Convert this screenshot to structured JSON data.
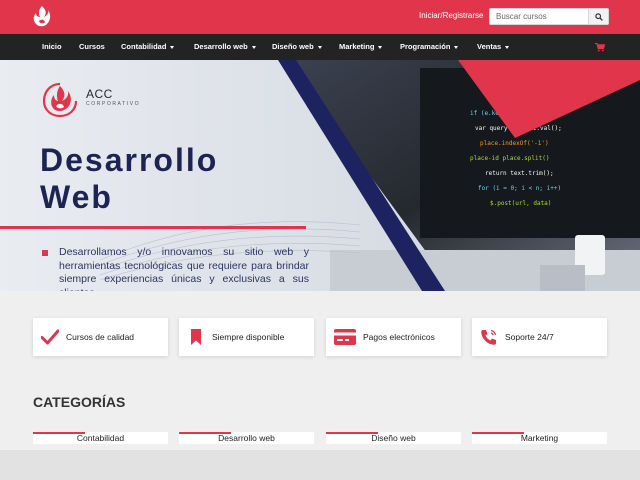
{
  "header": {
    "login_label": "Iniciar/Registrarse",
    "search_placeholder": "Buscar cursos",
    "brand_color": "#e0354a"
  },
  "nav": {
    "items": [
      {
        "label": "Inicio",
        "dropdown": false
      },
      {
        "label": "Cursos",
        "dropdown": false
      },
      {
        "label": "Contabilidad",
        "dropdown": true
      },
      {
        "label": "Desarrollo web",
        "dropdown": true
      },
      {
        "label": "Diseño web",
        "dropdown": true
      },
      {
        "label": "Marketing",
        "dropdown": true
      },
      {
        "label": "Programación",
        "dropdown": true
      },
      {
        "label": "Ventas",
        "dropdown": true
      }
    ],
    "cart_icon": "cart-icon"
  },
  "hero": {
    "brand_name": "ACC",
    "brand_sub": "CORPORATIVO",
    "title_line1": "Desarrollo",
    "title_line2": "Web",
    "description": "Desarrollamos y/o innovamos su sitio web y herramientas tecnológicas que requiere para brindar siempre experiencias únicas y exclusivas a sus clientes."
  },
  "features": [
    {
      "label": "Cursos de calidad",
      "icon": "check-icon"
    },
    {
      "label": "Siempre disponible",
      "icon": "bookmark-icon"
    },
    {
      "label": "Pagos electrónicos",
      "icon": "credit-card-icon"
    },
    {
      "label": "Soporte 24/7",
      "icon": "phone-icon"
    }
  ],
  "categories": {
    "heading": "CATEGORÍAS",
    "items": [
      "Contabilidad",
      "Desarrollo web",
      "Diseño web",
      "Marketing"
    ]
  }
}
